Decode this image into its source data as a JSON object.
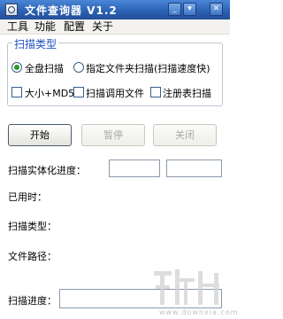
{
  "window": {
    "title": "文件查询器 V1.2",
    "minimize_glyph": "_",
    "dropdown_glyph": "▾",
    "close_glyph": "✕"
  },
  "menu": {
    "items": [
      "工具",
      "功能",
      "配置",
      "关于"
    ]
  },
  "scan_type_group": {
    "legend": "扫描类型",
    "options": {
      "full_disk": {
        "label": "全盘扫描",
        "selected": true
      },
      "folder": {
        "label": "指定文件夹扫描(扫描速度快)",
        "selected": false
      },
      "size_md5": {
        "label": "大小+MD5",
        "checked": false
      },
      "call_files": {
        "label": "扫描调用文件",
        "checked": false
      },
      "registry": {
        "label": "注册表扫描",
        "checked": false
      }
    }
  },
  "buttons": {
    "start": "开始",
    "pause": "暂停",
    "close": "关闭"
  },
  "info": {
    "progress_label": "扫描实体化进度：",
    "elapsed_label": "已用时：",
    "scan_type_label": "扫描类型：",
    "file_path_label": "文件路径：",
    "scan_progress_label": "扫描进度："
  },
  "watermark": {
    "text": "www.downxia.com"
  },
  "colors": {
    "titlebar": "#2a5fb0",
    "group_legend": "#1f4fbf",
    "radio_selected": "#2a9a2a"
  }
}
